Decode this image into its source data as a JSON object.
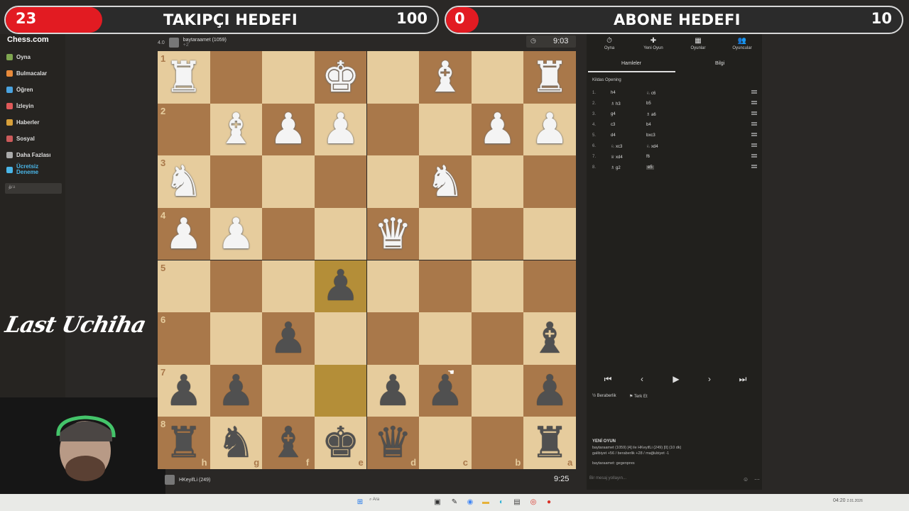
{
  "overlay": {
    "followers": {
      "count": "23",
      "title": "TAKIPÇI HEDEFI",
      "target": "100"
    },
    "subscribers": {
      "count": "0",
      "title": "ABONE HEDEFI",
      "target": "10"
    }
  },
  "sidebar": {
    "logo": "Chess.com",
    "items": [
      {
        "label": "Oyna",
        "color": "#7fa650"
      },
      {
        "label": "Bulmacalar",
        "color": "#e88a3a"
      },
      {
        "label": "Öğren",
        "color": "#4aa3df"
      },
      {
        "label": "İzleyin",
        "color": "#e05959"
      },
      {
        "label": "Haberler",
        "color": "#d8a03a"
      },
      {
        "label": "Sosyal",
        "color": "#cc5a5a"
      },
      {
        "label": "Daha Fazlası",
        "color": "#aaaaaa"
      },
      {
        "label": "Ücretsiz Deneme",
        "color": "#4ab6e8"
      }
    ],
    "search_placeholder": "Ara",
    "signature": "Last Uchiha"
  },
  "top_player": {
    "rating_badge": "4.0",
    "name": "baytaraamet (1059)",
    "clock": "9:03",
    "sub": "+2"
  },
  "bottom_player": {
    "name": "HKeyifLi (249)",
    "clock": "9:25"
  },
  "board": {
    "ranks": [
      "1",
      "2",
      "3",
      "4",
      "5",
      "6",
      "7",
      "8"
    ],
    "files": [
      "h",
      "g",
      "f",
      "e",
      "d",
      "c",
      "b",
      "a"
    ],
    "pieces": [
      [
        "wR",
        "",
        "",
        "wK",
        "",
        "wB",
        "",
        "wR"
      ],
      [
        "",
        "wB",
        "wP",
        "wP",
        "",
        "",
        "wP",
        "wP"
      ],
      [
        "wN",
        "",
        "",
        "",
        "",
        "wN",
        "",
        ""
      ],
      [
        "wP",
        "wP",
        "",
        "",
        "wQ",
        "",
        "",
        ""
      ],
      [
        "",
        "",
        "",
        "bP",
        "",
        "",
        "",
        ""
      ],
      [
        "",
        "",
        "bP",
        "",
        "",
        "",
        "",
        "bB"
      ],
      [
        "bP",
        "bP",
        "",
        "",
        "bP",
        "bP",
        "",
        "bP"
      ],
      [
        "bR",
        "bN",
        "bB",
        "bK",
        "bQ",
        "",
        "",
        "bR"
      ]
    ],
    "highlights": [
      [
        4,
        3
      ],
      [
        6,
        3
      ]
    ]
  },
  "right_panel": {
    "tabs": [
      {
        "label": "Oyna",
        "icon": "⏱"
      },
      {
        "label": "Yeni Oyun",
        "icon": "✚"
      },
      {
        "label": "Oyunlar",
        "icon": "▦"
      },
      {
        "label": "Oyuncular",
        "icon": "👥"
      }
    ],
    "subtabs": [
      "Hamleler",
      "Bilgi"
    ],
    "opening": "Kildas Opening",
    "moves": [
      {
        "n": "1.",
        "w": "h4",
        "b": "♘ c6"
      },
      {
        "n": "2.",
        "w": "♗ h3",
        "b": "b5"
      },
      {
        "n": "3.",
        "w": "g4",
        "b": "♗ a6"
      },
      {
        "n": "4.",
        "w": "c3",
        "b": "b4"
      },
      {
        "n": "5.",
        "w": "d4",
        "b": "bxc3"
      },
      {
        "n": "6.",
        "w": "♘ xc3",
        "b": "♘ xd4"
      },
      {
        "n": "7.",
        "w": "♕ xd4",
        "b": "f6"
      },
      {
        "n": "8.",
        "w": "♗ g2",
        "b": "e5"
      }
    ],
    "controls": [
      "⏮",
      "‹",
      "▶",
      "›",
      "⏭"
    ],
    "draw_label": "Beraberlik",
    "resign_label": "Terk Et",
    "chat": {
      "header": "YENİ OYUN",
      "line1": "baytaraamet (1059) [4] ile HKeyifLi (249) [0] (10 dk)",
      "line2": "galibiyet +56 / beraberlik +28 / mağlubiyet -1",
      "line3": "baytaraamet: gegenpres",
      "placeholder": "Bir mesaj yollayın..."
    }
  },
  "taskbar": {
    "search": "Ara",
    "time": "04:20",
    "date": "2.01.2026"
  }
}
